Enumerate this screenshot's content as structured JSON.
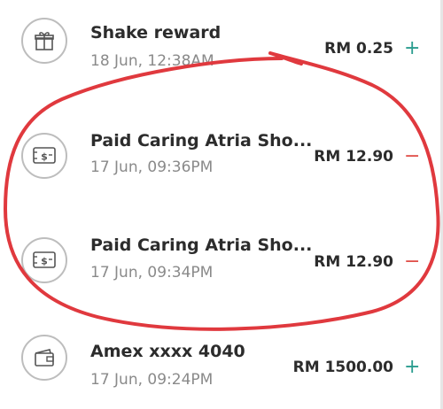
{
  "transactions": [
    {
      "title": "Shake reward",
      "time": "18 Jun, 12:38AM",
      "amount": "RM 0.25",
      "sign": "+",
      "icon": "gift-icon"
    },
    {
      "title": "Paid Caring Atria Sho...",
      "time": "17 Jun, 09:36PM",
      "amount": "RM 12.90",
      "sign": "−",
      "icon": "cash-icon"
    },
    {
      "title": "Paid Caring Atria Sho...",
      "time": "17 Jun, 09:34PM",
      "amount": "RM 12.90",
      "sign": "−",
      "icon": "cash-icon"
    },
    {
      "title": "Amex xxxx 4040",
      "time": "17 Jun, 09:24PM",
      "amount": "RM 1500.00",
      "sign": "+",
      "icon": "wallet-icon"
    }
  ],
  "colors": {
    "plus": "#2a9d8f",
    "minus": "#e0504a",
    "annotation": "#e0393e"
  }
}
